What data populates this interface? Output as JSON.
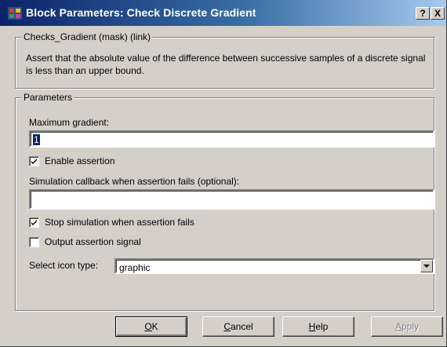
{
  "window": {
    "title": "Block Parameters: Check Discrete Gradient",
    "help_button": "?",
    "close_button": "X"
  },
  "block_info": {
    "legend": "Checks_Gradient (mask) (link)",
    "description": "Assert that the absolute value of the difference between successive samples of a discrete signal is less than an upper bound."
  },
  "parameters": {
    "legend": "Parameters",
    "max_gradient": {
      "label": "Maximum gradient:",
      "value": "1"
    },
    "enable_assertion": {
      "label": "Enable assertion",
      "checked": true
    },
    "callback": {
      "label": "Simulation callback when assertion fails (optional):",
      "value": ""
    },
    "stop_simulation": {
      "label": "Stop simulation when assertion fails",
      "checked": true
    },
    "output_signal": {
      "label": "Output assertion signal",
      "checked": false
    },
    "icon_type": {
      "label": "Select icon type:",
      "value": "graphic"
    }
  },
  "buttons": {
    "ok": {
      "label": "OK",
      "mnemonic": "O",
      "rest": "K"
    },
    "cancel": {
      "label": "Cancel",
      "mnemonic": "C",
      "rest": "ancel"
    },
    "help": {
      "label": "Help",
      "mnemonic": "H",
      "rest": "elp"
    },
    "apply": {
      "label": "Apply",
      "mnemonic": "A",
      "rest": "pply"
    }
  },
  "colors": {
    "title_active": "#0a246a",
    "dialog_face": "#d4d0c8",
    "selection": "#0a246a"
  },
  "icons": [
    "simulink-block-icon",
    "help-icon",
    "close-icon",
    "checkmark-icon",
    "dropdown-arrow-icon"
  ]
}
